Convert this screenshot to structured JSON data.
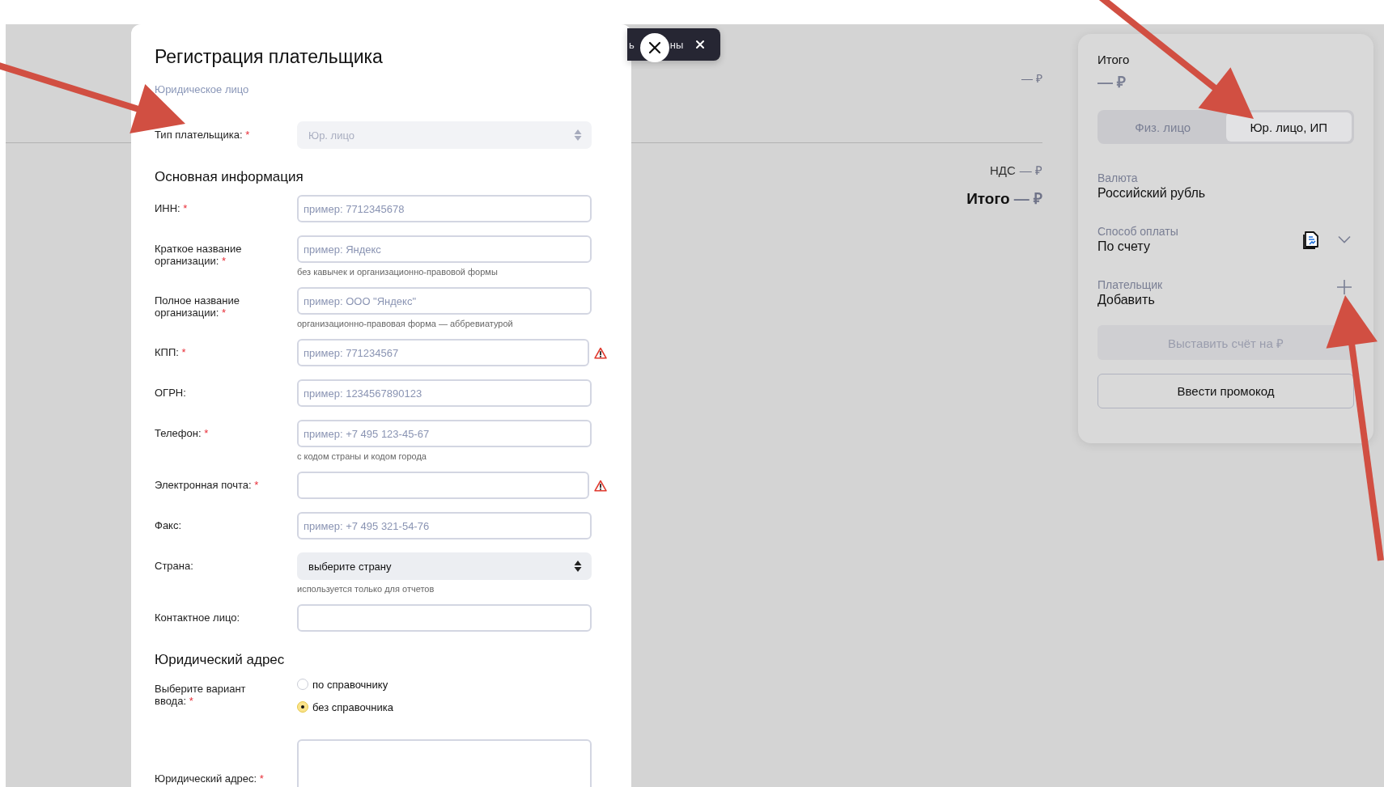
{
  "summary": {
    "amount": "— ₽",
    "vat_label": "НДС",
    "vat_amount": "— ₽",
    "total_label": "Итого",
    "total_amount": "— ₽"
  },
  "toast": {
    "text_parts": [
      "ь",
      "ны"
    ]
  },
  "modal": {
    "title": "Регистрация плательщика",
    "subtitle": "Юридическое лицо",
    "payer_type": {
      "label": "Тип плательщика:",
      "required_mark": "*",
      "value": "Юр. лицо",
      "disabled": true
    },
    "sections": [
      {
        "heading": "Основная информация",
        "fields": [
          {
            "kind": "input",
            "label": "ИНН:",
            "required_mark": "*",
            "placeholder": "пример: 7712345678"
          },
          {
            "kind": "input",
            "label": "Краткое название организации:",
            "required_mark": "*",
            "placeholder": "пример: Яндекс",
            "hint": "без кавычек и организационно-правовой формы"
          },
          {
            "kind": "input",
            "label": "Полное название организации:",
            "required_mark": "*",
            "placeholder": "пример: ООО \"Яндекс\"",
            "hint": "организационно-правовая форма — аббревиатурой"
          },
          {
            "kind": "input",
            "label": "КПП:",
            "required_mark": "*",
            "placeholder": "пример: 771234567",
            "warning": true
          },
          {
            "kind": "input",
            "label": "ОГРН:",
            "placeholder": "пример: 1234567890123"
          },
          {
            "kind": "input",
            "label": "Телефон:",
            "required_mark": "*",
            "placeholder": "пример: +7 495 123-45-67",
            "hint": "с кодом страны и кодом города"
          },
          {
            "kind": "input",
            "label": "Электронная почта:",
            "required_mark": "*",
            "warning": true
          },
          {
            "kind": "input",
            "label": "Факс:",
            "placeholder": "пример: +7 495 321-54-76"
          },
          {
            "kind": "select",
            "label": "Страна:",
            "value": "выберите страну",
            "hint": "используется только для отчетов"
          },
          {
            "kind": "input",
            "label": "Контактное лицо:"
          }
        ]
      },
      {
        "heading": "Юридический адрес",
        "fields": [
          {
            "kind": "radio",
            "label": "Выберите вариант ввода:",
            "required_mark": "*",
            "options": [
              {
                "label": "по справочнику",
                "selected": false
              },
              {
                "label": "без справочника",
                "selected": true
              }
            ]
          },
          {
            "kind": "textarea",
            "label": "Юридический адрес:",
            "required_mark": "*"
          }
        ]
      }
    ]
  },
  "panel": {
    "total_label": "Итого",
    "total_amount": "— ₽",
    "segments": [
      {
        "label": "Физ. лицо",
        "selected": false
      },
      {
        "label": "Юр. лицо, ИП",
        "selected": true
      }
    ],
    "rows": [
      {
        "kind": "text",
        "caption": "Валюта",
        "value": "Российский рубль"
      },
      {
        "kind": "dropdown",
        "caption": "Способ оплаты",
        "value": "По счету"
      },
      {
        "kind": "add",
        "caption": "Плательщик",
        "value": "Добавить"
      }
    ],
    "submit": {
      "label": "Выставить счёт на  ₽",
      "disabled": true
    },
    "promo": {
      "label": "Ввести промокод"
    }
  },
  "annotations": [
    {
      "kind": "arrow"
    },
    {
      "kind": "arrow"
    },
    {
      "kind": "arrow"
    }
  ]
}
